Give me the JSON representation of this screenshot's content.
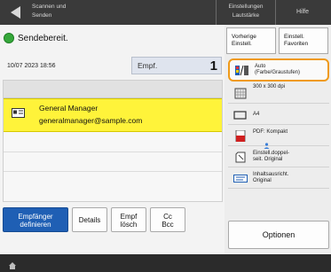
{
  "topbar": {
    "title_line1": "Scannen und",
    "title_line2": "Senden",
    "settings_line1": "Einstellungen",
    "settings_line2": "Lautstärke",
    "help": "Hilfe"
  },
  "status": {
    "text": "Sendebereit."
  },
  "main": {
    "datetime": "10/07 2023 18:56",
    "dest_type_label": "Empf.",
    "dest_count": "1",
    "destination": {
      "name": "General Manager",
      "email": "generalmanager@sample.com"
    },
    "buttons": {
      "empfaenger_line1": "Empfänger",
      "empfaenger_line2": "definieren",
      "details": "Details",
      "empf_loesch_line1": "Empf",
      "empf_loesch_line2": "lösch",
      "cc_line1": "Cc",
      "cc_line2": "Bcc"
    }
  },
  "right": {
    "previous_line1": "Vorherige",
    "previous_line2": "Einstell.",
    "favorites_line1": "Einstell.",
    "favorites_line2": "Favoriten",
    "options": [
      {
        "line1": "Auto",
        "line2": "(Farbe/Graustufen)"
      },
      {
        "line1": "300 x 300 dpi",
        "line2": ""
      },
      {
        "line1": "A4",
        "line2": ""
      },
      {
        "line1": "PDF: Kompakt",
        "line2": ""
      },
      {
        "line1": "Einstell.doppel-",
        "line2": "seit. Original"
      },
      {
        "line1": "Inhaltsausricht.",
        "line2": "Original"
      }
    ],
    "options_button": "Optionen"
  },
  "colors": {
    "accent_blue": "#1f5fb4",
    "highlight_yellow": "#fff33a",
    "selected_orange": "#f09a18",
    "ready_green": "#35a83a"
  },
  "icons": [
    "back-arrow-icon",
    "ready-status-icon",
    "address-card-icon",
    "color-mode-icon",
    "resolution-icon",
    "paper-size-icon",
    "pdf-file-icon",
    "duplex-icon",
    "orientation-icon",
    "home-icon"
  ]
}
